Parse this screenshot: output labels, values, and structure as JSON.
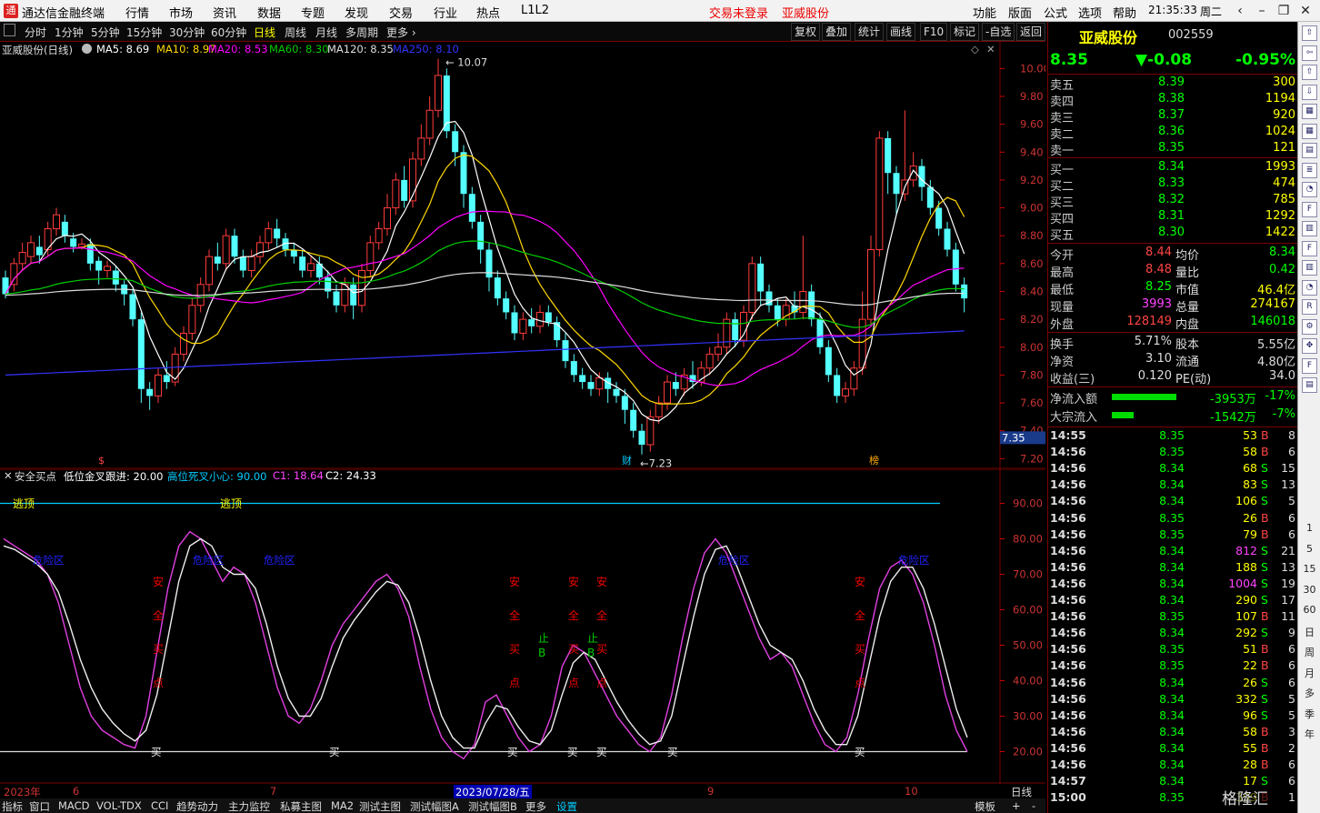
{
  "app": {
    "title": "通达信金融终端",
    "status_login": "交易未登录",
    "status_stock": "亚威股份",
    "time": "21:35:33",
    "weekday": "周二"
  },
  "menu": [
    "行情",
    "市场",
    "资讯",
    "数据",
    "专题",
    "发现",
    "交易",
    "行业",
    "热点",
    "L1L2"
  ],
  "menu_right": [
    "功能",
    "版面",
    "公式",
    "选项",
    "帮助"
  ],
  "periods": [
    "分时",
    "1分钟",
    "5分钟",
    "15分钟",
    "30分钟",
    "60分钟",
    "日线",
    "周线",
    "月线",
    "多周期",
    "更多"
  ],
  "active_period": "日线",
  "tools_right": [
    "复权",
    "叠加",
    "统计",
    "画线",
    "F10",
    "标记",
    "-自选",
    "返回"
  ],
  "chart_header": {
    "name": "亚威股份(日线)",
    "ma5": "MA5: 8.69",
    "ma10": "MA10: 8.97",
    "ma20": "MA20: 8.53",
    "ma60": "MA60: 8.30",
    "ma120": "MA120: 8.35",
    "ma250": "MA250: 8.10"
  },
  "colors": {
    "ma5": "#ffffff",
    "ma10": "#ffd700",
    "ma20": "#ff00ff",
    "ma60": "#00cc00",
    "ma120": "#dddddd",
    "ma250": "#3333ff",
    "up": "#ff3b3b",
    "down": "#54ffff"
  },
  "price_axis": {
    "ticks": [
      "10.00",
      "9.80",
      "9.60",
      "9.40",
      "9.20",
      "9.00",
      "8.80",
      "8.60",
      "8.40",
      "8.20",
      "8.00",
      "7.80",
      "7.60",
      "7.40",
      "7.20"
    ],
    "current": "7.35",
    "high_label": "10.07",
    "low_label": "7.23"
  },
  "chart_flags": {
    "left": "$",
    "fin": "财",
    "bang": "榜"
  },
  "indicator": {
    "name": "安全买点",
    "p1": "低位金叉跟进: 20.00",
    "p2": "高位死叉小心: 90.00",
    "c1": "C1: 18.64",
    "c2": "C2: 24.33"
  },
  "ind_axis": [
    "90.00",
    "80.00",
    "70.00",
    "60.00",
    "50.00",
    "40.00",
    "30.00",
    "20.00"
  ],
  "ind_labels": {
    "escape": "逃顶",
    "danger": "危险区",
    "safe": [
      "安",
      "全",
      "买",
      "点"
    ],
    "stop": [
      "止",
      "B"
    ],
    "buy": "买"
  },
  "dates": {
    "y2023": "2023年",
    "m6": "6",
    "m7": "7",
    "current": "2023/07/28/五",
    "m9": "9",
    "m10": "10",
    "period": "日线"
  },
  "bottom_tabs": [
    "指标",
    "窗口",
    "MACD",
    "VOL-TDX",
    "CCI",
    "趋势动力",
    "主力监控",
    "私募主图",
    "MA2",
    "测试主图",
    "测试幅图A",
    "测试幅图B",
    "更多",
    "设置"
  ],
  "bottom_right": [
    "模板",
    "+",
    "-"
  ],
  "quote": {
    "name": "亚威股份",
    "code": "002559",
    "price": "8.35",
    "change": "▼-0.08",
    "pct": "-0.95%",
    "sells": [
      {
        "l": "卖五",
        "p": "8.39",
        "v": "300"
      },
      {
        "l": "卖四",
        "p": "8.38",
        "v": "1194"
      },
      {
        "l": "卖三",
        "p": "8.37",
        "v": "920"
      },
      {
        "l": "卖二",
        "p": "8.36",
        "v": "1024"
      },
      {
        "l": "卖一",
        "p": "8.35",
        "v": "121"
      }
    ],
    "buys": [
      {
        "l": "买一",
        "p": "8.34",
        "v": "1993"
      },
      {
        "l": "买二",
        "p": "8.33",
        "v": "474"
      },
      {
        "l": "买三",
        "p": "8.32",
        "v": "785"
      },
      {
        "l": "买四",
        "p": "8.31",
        "v": "1292"
      },
      {
        "l": "买五",
        "p": "8.30",
        "v": "1422"
      }
    ],
    "stats": [
      {
        "l1": "今开",
        "v1": "8.44",
        "l2": "均价",
        "v2": "8.34"
      },
      {
        "l1": "最高",
        "v1": "8.48",
        "l2": "量比",
        "v2": "0.42"
      },
      {
        "l1": "最低",
        "v1": "8.25",
        "l2": "市值",
        "v2": "46.4亿"
      },
      {
        "l1": "现量",
        "v1": "3993",
        "l2": "总量",
        "v2": "274167"
      },
      {
        "l1": "外盘",
        "v1": "128149",
        "l2": "内盘",
        "v2": "146018"
      }
    ],
    "stats2": [
      {
        "l1": "换手",
        "v1": "5.71%",
        "l2": "股本",
        "v2": "5.55亿"
      },
      {
        "l1": "净资",
        "v1": "3.10",
        "l2": "流通",
        "v2": "4.80亿"
      },
      {
        "l1": "收益(三)",
        "v1": "0.120",
        "l2": "PE(动)",
        "v2": "34.0"
      }
    ],
    "flows": [
      {
        "l": "净流入额",
        "v": "-3953万",
        "p": "-17%",
        "bar": 0.6
      },
      {
        "l": "大宗流入",
        "v": "-1542万",
        "p": "-7%",
        "bar": 0.2
      }
    ],
    "ticks": [
      {
        "t": "14:55",
        "p": "8.35",
        "v": "53",
        "d": "B",
        "n": "8"
      },
      {
        "t": "14:56",
        "p": "8.35",
        "v": "58",
        "d": "B",
        "n": "6"
      },
      {
        "t": "14:56",
        "p": "8.34",
        "v": "68",
        "d": "S",
        "n": "15"
      },
      {
        "t": "14:56",
        "p": "8.34",
        "v": "83",
        "d": "S",
        "n": "13"
      },
      {
        "t": "14:56",
        "p": "8.34",
        "v": "106",
        "d": "S",
        "n": "5"
      },
      {
        "t": "14:56",
        "p": "8.35",
        "v": "26",
        "d": "B",
        "n": "6"
      },
      {
        "t": "14:56",
        "p": "8.35",
        "v": "79",
        "d": "B",
        "n": "6"
      },
      {
        "t": "14:56",
        "p": "8.34",
        "v": "812",
        "d": "S",
        "n": "21"
      },
      {
        "t": "14:56",
        "p": "8.34",
        "v": "188",
        "d": "S",
        "n": "13"
      },
      {
        "t": "14:56",
        "p": "8.34",
        "v": "1004",
        "d": "S",
        "n": "19"
      },
      {
        "t": "14:56",
        "p": "8.34",
        "v": "290",
        "d": "S",
        "n": "17"
      },
      {
        "t": "14:56",
        "p": "8.35",
        "v": "107",
        "d": "B",
        "n": "11"
      },
      {
        "t": "14:56",
        "p": "8.34",
        "v": "292",
        "d": "S",
        "n": "9"
      },
      {
        "t": "14:56",
        "p": "8.35",
        "v": "51",
        "d": "B",
        "n": "6"
      },
      {
        "t": "14:56",
        "p": "8.35",
        "v": "22",
        "d": "B",
        "n": "6"
      },
      {
        "t": "14:56",
        "p": "8.34",
        "v": "26",
        "d": "S",
        "n": "6"
      },
      {
        "t": "14:56",
        "p": "8.34",
        "v": "332",
        "d": "S",
        "n": "5"
      },
      {
        "t": "14:56",
        "p": "8.34",
        "v": "96",
        "d": "S",
        "n": "5"
      },
      {
        "t": "14:56",
        "p": "8.34",
        "v": "58",
        "d": "B",
        "n": "3"
      },
      {
        "t": "14:56",
        "p": "8.34",
        "v": "55",
        "d": "B",
        "n": "2"
      },
      {
        "t": "14:56",
        "p": "8.34",
        "v": "28",
        "d": "B",
        "n": "6"
      },
      {
        "t": "14:57",
        "p": "8.34",
        "v": "17",
        "d": "S",
        "n": "6"
      },
      {
        "t": "15:00",
        "p": "8.35",
        "v": "399",
        "d": "B",
        "n": "1"
      }
    ],
    "watermark": "格隆汇"
  },
  "iconbar": [
    "1",
    "5",
    "15",
    "30",
    "60",
    "日",
    "周",
    "月",
    "多",
    "季",
    "年"
  ],
  "chart_data": {
    "type": "candlestick",
    "ylim": [
      7.15,
      10.1
    ],
    "candles": [
      [
        8.5,
        8.38,
        8.55,
        8.35
      ],
      [
        8.45,
        8.6,
        8.64,
        8.4
      ],
      [
        8.6,
        8.68,
        8.75,
        8.55
      ],
      [
        8.65,
        8.75,
        8.8,
        8.6
      ],
      [
        8.72,
        8.66,
        8.8,
        8.6
      ],
      [
        8.7,
        8.85,
        8.9,
        8.65
      ],
      [
        8.85,
        8.95,
        9.0,
        8.8
      ],
      [
        8.9,
        8.8,
        8.95,
        8.75
      ],
      [
        8.78,
        8.72,
        8.82,
        8.68
      ],
      [
        8.72,
        8.74,
        8.78,
        8.7
      ],
      [
        8.74,
        8.6,
        8.78,
        8.55
      ],
      [
        8.62,
        8.55,
        8.65,
        8.45
      ],
      [
        8.55,
        8.58,
        8.62,
        8.5
      ],
      [
        8.55,
        8.45,
        8.58,
        8.4
      ],
      [
        8.45,
        8.38,
        8.48,
        8.3
      ],
      [
        8.38,
        8.2,
        8.42,
        8.15
      ],
      [
        8.2,
        7.7,
        8.25,
        7.6
      ],
      [
        7.7,
        7.65,
        7.75,
        7.55
      ],
      [
        7.65,
        7.8,
        7.85,
        7.6
      ],
      [
        7.8,
        7.75,
        7.9,
        7.7
      ],
      [
        7.75,
        7.95,
        8.0,
        7.72
      ],
      [
        7.95,
        8.1,
        8.15,
        7.9
      ],
      [
        8.1,
        8.3,
        8.35,
        8.05
      ],
      [
        8.3,
        8.45,
        8.5,
        8.25
      ],
      [
        8.45,
        8.65,
        8.7,
        8.4
      ],
      [
        8.65,
        8.6,
        8.75,
        8.55
      ],
      [
        8.6,
        8.8,
        8.85,
        8.55
      ],
      [
        8.8,
        8.65,
        8.85,
        8.6
      ],
      [
        8.65,
        8.55,
        8.7,
        8.5
      ],
      [
        8.55,
        8.65,
        8.7,
        8.5
      ],
      [
        8.65,
        8.75,
        8.8,
        8.6
      ],
      [
        8.75,
        8.85,
        8.9,
        8.7
      ],
      [
        8.85,
        8.78,
        8.92,
        8.72
      ],
      [
        8.78,
        8.7,
        8.82,
        8.65
      ],
      [
        8.7,
        8.65,
        8.75,
        8.6
      ],
      [
        8.65,
        8.55,
        8.7,
        8.5
      ],
      [
        8.55,
        8.6,
        8.65,
        8.5
      ],
      [
        8.6,
        8.5,
        8.65,
        8.45
      ],
      [
        8.5,
        8.4,
        8.55,
        8.35
      ],
      [
        8.4,
        8.3,
        8.45,
        8.25
      ],
      [
        8.3,
        8.45,
        8.5,
        8.25
      ],
      [
        8.45,
        8.3,
        8.5,
        8.2
      ],
      [
        8.3,
        8.55,
        8.6,
        8.25
      ],
      [
        8.55,
        8.75,
        8.8,
        8.5
      ],
      [
        8.75,
        8.85,
        8.9,
        8.7
      ],
      [
        8.85,
        9.0,
        9.1,
        8.8
      ],
      [
        9.0,
        9.2,
        9.25,
        8.95
      ],
      [
        9.2,
        9.05,
        9.3,
        9.0
      ],
      [
        9.05,
        9.35,
        9.4,
        9.0
      ],
      [
        9.35,
        9.5,
        9.6,
        9.3
      ],
      [
        9.5,
        9.7,
        9.8,
        9.45
      ],
      [
        9.7,
        9.95,
        10.07,
        9.65
      ],
      [
        9.95,
        9.55,
        10.0,
        9.5
      ],
      [
        9.55,
        9.4,
        9.6,
        9.3
      ],
      [
        9.4,
        9.1,
        9.45,
        9.0
      ],
      [
        9.1,
        8.9,
        9.15,
        8.85
      ],
      [
        8.9,
        8.7,
        8.95,
        8.6
      ],
      [
        8.7,
        8.5,
        8.75,
        8.4
      ],
      [
        8.5,
        8.35,
        8.55,
        8.3
      ],
      [
        8.35,
        8.25,
        8.4,
        8.2
      ],
      [
        8.25,
        8.1,
        8.3,
        8.05
      ],
      [
        8.1,
        8.2,
        8.25,
        8.05
      ],
      [
        8.2,
        8.15,
        8.28,
        8.1
      ],
      [
        8.15,
        8.25,
        8.3,
        8.1
      ],
      [
        8.25,
        8.18,
        8.3,
        8.15
      ],
      [
        8.18,
        8.05,
        8.22,
        8.0
      ],
      [
        8.05,
        7.9,
        8.1,
        7.85
      ],
      [
        7.9,
        7.8,
        7.95,
        7.75
      ],
      [
        7.8,
        7.75,
        7.85,
        7.7
      ],
      [
        7.75,
        7.7,
        7.8,
        7.65
      ],
      [
        7.7,
        7.78,
        7.82,
        7.65
      ],
      [
        7.78,
        7.7,
        7.82,
        7.6
      ],
      [
        7.7,
        7.65,
        7.75,
        7.6
      ],
      [
        7.65,
        7.55,
        7.7,
        7.45
      ],
      [
        7.55,
        7.4,
        7.6,
        7.35
      ],
      [
        7.4,
        7.3,
        7.45,
        7.23
      ],
      [
        7.3,
        7.5,
        7.55,
        7.25
      ],
      [
        7.5,
        7.6,
        7.65,
        7.45
      ],
      [
        7.6,
        7.75,
        7.8,
        7.55
      ],
      [
        7.75,
        7.7,
        7.82,
        7.65
      ],
      [
        7.7,
        7.8,
        7.85,
        7.65
      ],
      [
        7.8,
        7.75,
        7.9,
        7.7
      ],
      [
        7.75,
        7.85,
        7.9,
        7.72
      ],
      [
        7.85,
        7.95,
        8.0,
        7.8
      ],
      [
        7.95,
        8.0,
        8.1,
        7.9
      ],
      [
        8.0,
        8.2,
        8.25,
        7.95
      ],
      [
        8.2,
        8.05,
        8.25,
        8.0
      ],
      [
        8.05,
        8.25,
        8.3,
        8.0
      ],
      [
        8.25,
        8.6,
        8.65,
        8.2
      ],
      [
        8.6,
        8.4,
        8.65,
        8.3
      ],
      [
        8.4,
        8.3,
        8.45,
        8.25
      ],
      [
        8.3,
        8.2,
        8.35,
        8.15
      ],
      [
        8.2,
        8.3,
        8.35,
        8.15
      ],
      [
        8.3,
        8.25,
        8.4,
        8.2
      ],
      [
        8.25,
        8.4,
        8.8,
        8.2
      ],
      [
        8.4,
        8.2,
        8.45,
        8.15
      ],
      [
        8.2,
        8.0,
        8.25,
        7.95
      ],
      [
        8.0,
        7.8,
        8.05,
        7.75
      ],
      [
        7.8,
        7.65,
        7.85,
        7.6
      ],
      [
        7.65,
        7.7,
        7.75,
        7.6
      ],
      [
        7.7,
        7.85,
        7.9,
        7.65
      ],
      [
        7.85,
        8.2,
        8.4,
        7.8
      ],
      [
        8.2,
        8.7,
        8.8,
        8.15
      ],
      [
        8.7,
        9.5,
        9.55,
        8.65
      ],
      [
        9.5,
        9.25,
        9.55,
        9.1
      ],
      [
        9.25,
        9.1,
        9.3,
        8.95
      ],
      [
        9.1,
        9.2,
        9.7,
        9.05
      ],
      [
        9.2,
        9.3,
        9.4,
        9.15
      ],
      [
        9.3,
        9.15,
        9.35,
        9.05
      ],
      [
        9.15,
        9.0,
        9.2,
        8.95
      ],
      [
        9.0,
        8.85,
        9.05,
        8.8
      ],
      [
        8.85,
        8.7,
        8.9,
        8.65
      ],
      [
        8.7,
        8.45,
        8.75,
        8.4
      ],
      [
        8.45,
        8.35,
        8.5,
        8.25
      ]
    ],
    "ind_ylim": [
      15,
      95
    ],
    "k_line": [
      80,
      78,
      76,
      74,
      70,
      62,
      50,
      38,
      30,
      26,
      24,
      22,
      21,
      30,
      48,
      66,
      78,
      82,
      80,
      74,
      68,
      72,
      70,
      62,
      50,
      38,
      30,
      28,
      32,
      40,
      50,
      56,
      60,
      64,
      68,
      70,
      66,
      58,
      44,
      32,
      24,
      20,
      18,
      22,
      34,
      36,
      30,
      24,
      20,
      22,
      30,
      44,
      50,
      48,
      42,
      36,
      30,
      26,
      22,
      20,
      24,
      36,
      52,
      66,
      76,
      80,
      76,
      68,
      60,
      52,
      46,
      48,
      44,
      36,
      28,
      22,
      20,
      24,
      36,
      52,
      66,
      72,
      74,
      70,
      62,
      50,
      36,
      26,
      20
    ],
    "d_line": [
      78,
      77,
      75,
      73,
      70,
      65,
      56,
      46,
      38,
      32,
      28,
      25,
      23,
      26,
      36,
      52,
      68,
      78,
      80,
      78,
      72,
      70,
      70,
      66,
      56,
      44,
      35,
      30,
      30,
      35,
      44,
      52,
      57,
      61,
      65,
      68,
      67,
      62,
      52,
      40,
      30,
      24,
      21,
      21,
      28,
      33,
      32,
      27,
      23,
      22,
      26,
      36,
      45,
      48,
      46,
      40,
      34,
      29,
      25,
      22,
      23,
      30,
      44,
      58,
      70,
      77,
      78,
      72,
      64,
      56,
      50,
      48,
      46,
      40,
      32,
      26,
      22,
      22,
      30,
      44,
      58,
      68,
      72,
      72,
      66,
      56,
      44,
      32,
      24
    ],
    "ma_note": "moving averages overlaid"
  }
}
